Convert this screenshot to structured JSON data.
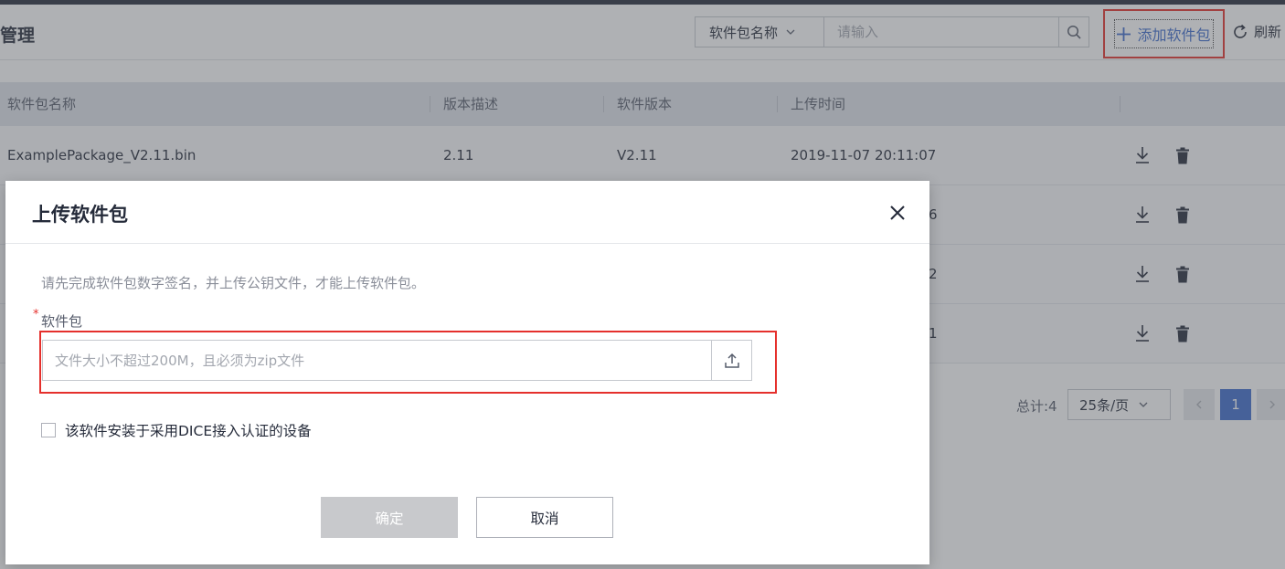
{
  "header": {
    "title": "管理",
    "search": {
      "field_selected": "软件包名称",
      "placeholder": "请输入"
    },
    "add_label": "添加软件包",
    "refresh_label": "刷新"
  },
  "table": {
    "columns": [
      "软件包名称",
      "版本描述",
      "软件版本",
      "上传时间"
    ],
    "rows": [
      {
        "name": "ExamplePackage_V2.11.bin",
        "desc": "2.11",
        "version": "V2.11",
        "time": "2019-11-07 20:11:07"
      },
      {
        "time_tail": "6"
      },
      {
        "time_tail": "2"
      },
      {
        "time_tail": "1"
      }
    ]
  },
  "pagination": {
    "total": "总计:4",
    "page_size": "25条/页",
    "current_page": "1"
  },
  "modal": {
    "title": "上传软件包",
    "hint": "请先完成软件包数字签名，并上传公钥文件，才能上传软件包。",
    "required_mark": "*",
    "field_label": "软件包",
    "file_placeholder": "文件大小不超过200M，且必须为zip文件",
    "checkbox_label": "该软件安装于采用DICE接入认证的设备",
    "checkbox_checked": false,
    "confirm_label": "确定",
    "cancel_label": "取消"
  },
  "colors": {
    "accent": "#3e6bce",
    "highlight_red": "#e5302c",
    "disabled_button": "#c8c9cc"
  },
  "icons": {
    "search": "search-icon",
    "chevron": "chevron-down-icon",
    "add": "plus-icon",
    "refresh": "refresh-icon",
    "download": "download-icon",
    "delete": "trash-icon",
    "close": "close-icon",
    "upload": "upload-icon",
    "prev": "chevron-left-icon",
    "next": "chevron-right-icon"
  }
}
